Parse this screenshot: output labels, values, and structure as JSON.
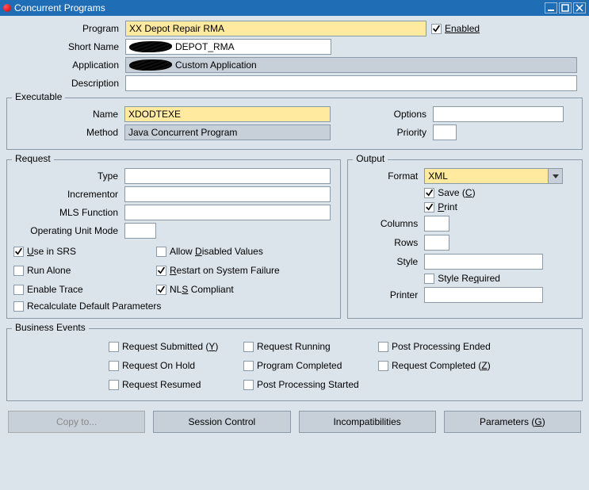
{
  "title": "Concurrent Programs",
  "top": {
    "program_label": "Program",
    "program_value": "XX Depot Repair RMA",
    "enabled_label": "Enabled",
    "enabled_checked": true,
    "short_name_label": "Short Name",
    "short_name_value": "DEPOT_RMA",
    "application_label": "Application",
    "application_value": "Custom Application",
    "description_label": "Description",
    "description_value": ""
  },
  "executable": {
    "legend": "Executable",
    "name_label": "Name",
    "name_value": "XDODTEXE",
    "method_label": "Method",
    "method_value": "Java Concurrent Program",
    "options_label": "Options",
    "options_value": "",
    "priority_label": "Priority",
    "priority_value": ""
  },
  "request": {
    "legend": "Request",
    "type_label": "Type",
    "type_value": "",
    "incrementor_label": "Incrementor",
    "incrementor_value": "",
    "mls_label": "MLS Function",
    "mls_value": "",
    "oum_label": "Operating Unit Mode",
    "oum_value": "",
    "use_in_srs": "Use in SRS",
    "run_alone": "Run Alone",
    "enable_trace": "Enable Trace",
    "recalc": "Recalculate Default Parameters",
    "allow_disabled_pre": "Allow ",
    "allow_disabled_u": "D",
    "allow_disabled_post": "isabled Values",
    "restart_pre": "",
    "restart_u": "R",
    "restart_post": "estart on System Failure",
    "nls_pre": "NL",
    "nls_u": "S",
    "nls_post": " Compliant"
  },
  "output": {
    "legend": "Output",
    "format_label": "Format",
    "format_value": "XML",
    "save_pre": "Save (",
    "save_u": "C",
    "save_post": ")",
    "print_u": "P",
    "print_post": "rint",
    "columns_label": "Columns",
    "columns_value": "",
    "rows_label": "Rows",
    "rows_value": "",
    "style_label": "Style",
    "style_value": "",
    "style_req_pre": "Style Re",
    "style_req_u": "q",
    "style_req_post": "uired",
    "printer_label": "Printer",
    "printer_value": ""
  },
  "events": {
    "legend": "Business Events",
    "req_submitted_pre": "Request Submitted (",
    "req_submitted_u": "Y",
    "req_submitted_post": ")",
    "req_on_hold": "Request On Hold",
    "req_resumed": "Request Resumed",
    "req_running": "Request Running",
    "program_completed": "Program Completed",
    "pp_started": "Post Processing Started",
    "pp_ended": "Post Processing Ended",
    "req_completed_pre": "Request Completed (",
    "req_completed_u": "Z",
    "req_completed_post": ")"
  },
  "buttons": {
    "copy_to": "Copy to...",
    "session_control": "Session Control",
    "incompat": "Incompatibilities",
    "parameters_pre": "Parameters (",
    "parameters_u": "G",
    "parameters_post": ")"
  }
}
